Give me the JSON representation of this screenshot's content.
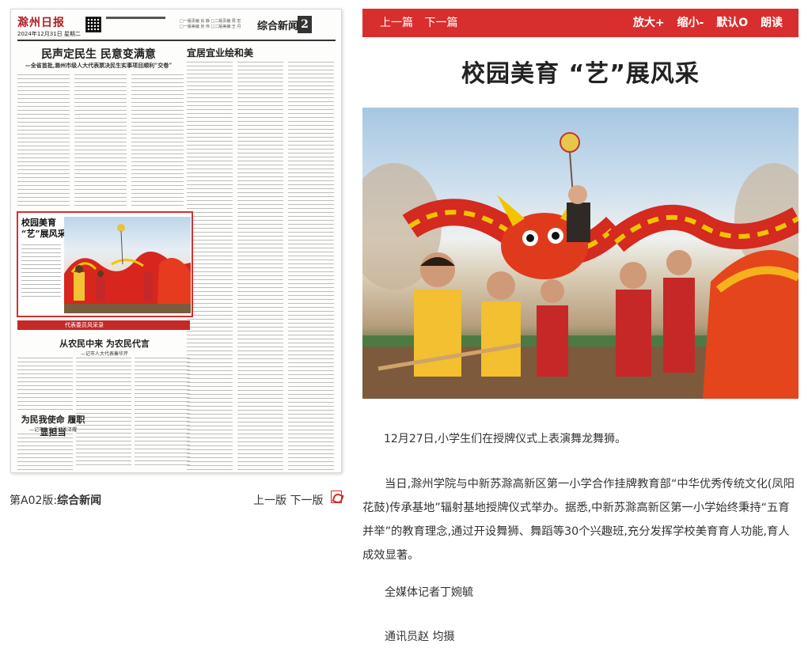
{
  "newspaper": {
    "logo": "滁州日报",
    "date": "2024年12月31日 星期二",
    "section": "综合新闻",
    "page_number": "2",
    "edit_info": "□一版责编 肖 静 □二版责编 周 宏\n□一版美编 张 伟 □二版美编 王 丹",
    "headlines": [
      {
        "title": "民声定民生 民意变满意",
        "sub": "—全省首批,滁州市级人大代表票决民生实事项目顺利“交卷”"
      },
      {
        "title": "宜居宜业绘和美"
      },
      {
        "title": "从农民中来 为农民代言",
        "sub": "—记市人大代表秦华芹"
      },
      {
        "title": "为民我使命 履职显担当",
        "sub": "—记市政协委员张泽耀"
      }
    ],
    "feature_title": "校园美育\n“艺”展风采",
    "banner": "代表委员风采录"
  },
  "page_label": {
    "prefix": "第A02版:",
    "name": "综合新闻"
  },
  "left_nav": {
    "prev": "上一版",
    "next": "下一版"
  },
  "toolbar": {
    "prev": "上一篇",
    "next": "下一篇",
    "zoom_in": "放大+",
    "zoom_out": "缩小-",
    "default": "默认O",
    "read": "朗读"
  },
  "article": {
    "title": "校园美育 “艺”展风采",
    "caption": "12月27日,小学生们在授牌仪式上表演舞龙舞狮。",
    "paragraph": "当日,滁州学院与中新苏滁高新区第一小学合作挂牌教育部“中华优秀传统文化(凤阳花鼓)传承基地”辐射基地授牌仪式举办。据悉,中新苏滁高新区第一小学始终秉持“五育并举”的教育理念,通过开设舞狮、舞蹈等30个兴趣班,充分发挥学校美育育人功能,育人成效显著。",
    "reporter": "全媒体记者丁婉毓",
    "photographer": "通讯员赵 均摄"
  },
  "colors": {
    "accent": "#d92e2e",
    "frame": "#d32f2f"
  }
}
